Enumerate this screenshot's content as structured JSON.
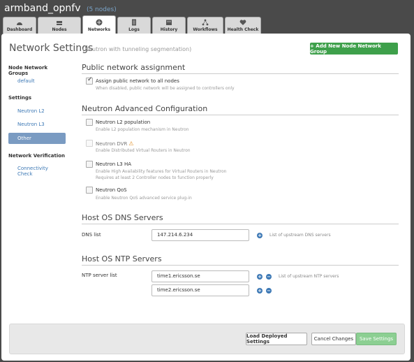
{
  "env": {
    "name": "armband_opnfv",
    "nodes": "(5 nodes)"
  },
  "tabs": [
    {
      "label": "Dashboard",
      "icon": "dashboard-icon"
    },
    {
      "label": "Nodes",
      "icon": "server-icon"
    },
    {
      "label": "Networks",
      "icon": "network-icon",
      "active": true
    },
    {
      "label": "Logs",
      "icon": "logs-icon"
    },
    {
      "label": "History",
      "icon": "history-icon"
    },
    {
      "label": "Workflows",
      "icon": "workflows-icon"
    },
    {
      "label": "Health Check",
      "icon": "health-check-icon"
    }
  ],
  "page": {
    "title": "Network Settings",
    "subtitle": "(Neutron with tunneling segmentation)",
    "add_button": "+ Add New Node Network Group"
  },
  "nav": {
    "groups_heading": "Node Network Groups",
    "default_item": "default",
    "settings_heading": "Settings",
    "l2": "Neutron L2",
    "l3": "Neutron L3",
    "other": "Other",
    "verification_heading": "Network Verification",
    "connectivity_1": "Connectivity",
    "connectivity_2": "Check"
  },
  "public": {
    "title": "Public network assignment",
    "assign_label": "Assign public network to all nodes",
    "assign_desc": "When disabled, public network will be assigned to controllers only",
    "assign_checked": true
  },
  "neutron": {
    "title": "Neutron Advanced Configuration",
    "l2pop_label": "Neutron L2 population",
    "l2pop_desc": "Enable L2 population mechanism in Neutron",
    "dvr_label": "Neutron DVR",
    "dvr_desc": "Enable Distributed Virtual Routers in Neutron",
    "l3ha_label": "Neutron L3 HA",
    "l3ha_desc1": "Enable High Availability features for Virtual Routers in Neutron",
    "l3ha_desc2": "Requires at least 2 Controller nodes to function properly",
    "qos_label": "Neutron QoS",
    "qos_desc": "Enable Neutron QoS advanced service plug-in"
  },
  "dns": {
    "title": "Host OS DNS Servers",
    "label": "DNS list",
    "value": "147.214.6.234",
    "hint": "List of upstream DNS servers"
  },
  "ntp": {
    "title": "Host OS NTP Servers",
    "label": "NTP server list",
    "value1": "time1.ericsson.se",
    "value2": "time2.ericsson.se",
    "hint": "List of upstream NTP servers"
  },
  "footer": {
    "load": "Load Deployed Settings",
    "cancel": "Cancel Changes",
    "save": "Save Settings"
  },
  "colors": {
    "accent": "#3ea04b",
    "link": "#3c78b5",
    "nav_selected": "#7a9bc2"
  }
}
